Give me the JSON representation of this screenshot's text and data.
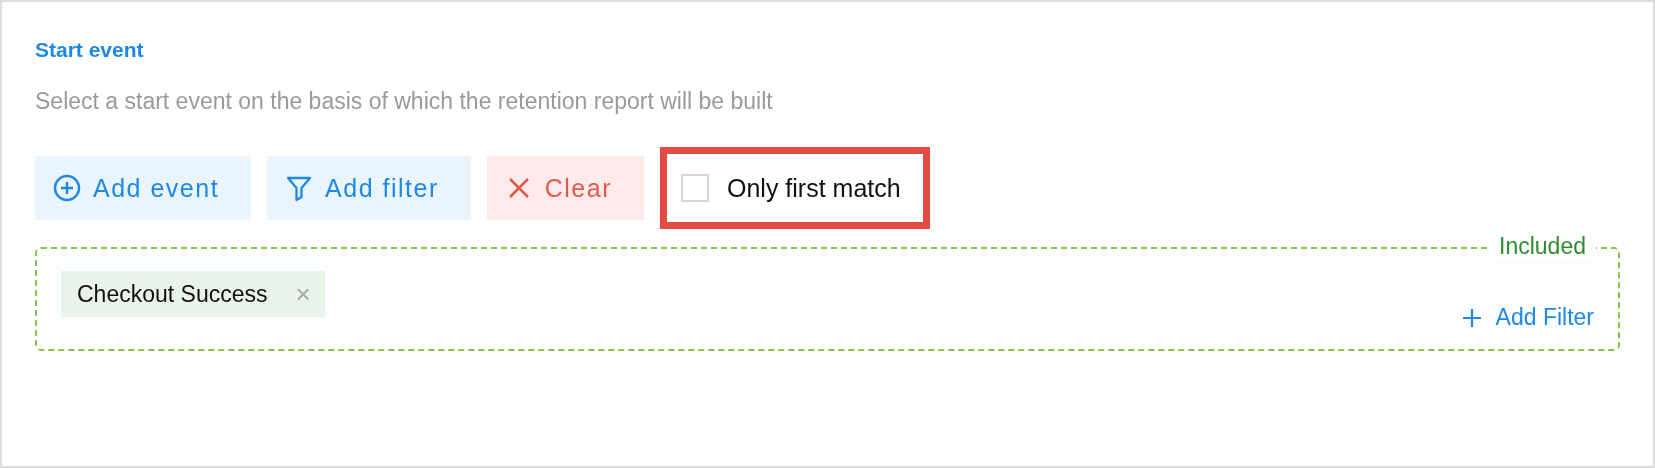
{
  "section": {
    "title": "Start event",
    "description": "Select a start event on the basis of which the retention report will be built"
  },
  "toolbar": [
    {
      "kind": "add-event",
      "label": "Add event"
    },
    {
      "kind": "add-filter",
      "label": "Add filter"
    },
    {
      "kind": "clear",
      "label": "Clear"
    }
  ],
  "option": {
    "label": "Only first match",
    "checked": false,
    "highlighted": true
  },
  "included": {
    "legend": "Included",
    "events": [
      {
        "label": "Checkout Success",
        "remove": "×"
      }
    ],
    "add_filter": "Add Filter"
  }
}
